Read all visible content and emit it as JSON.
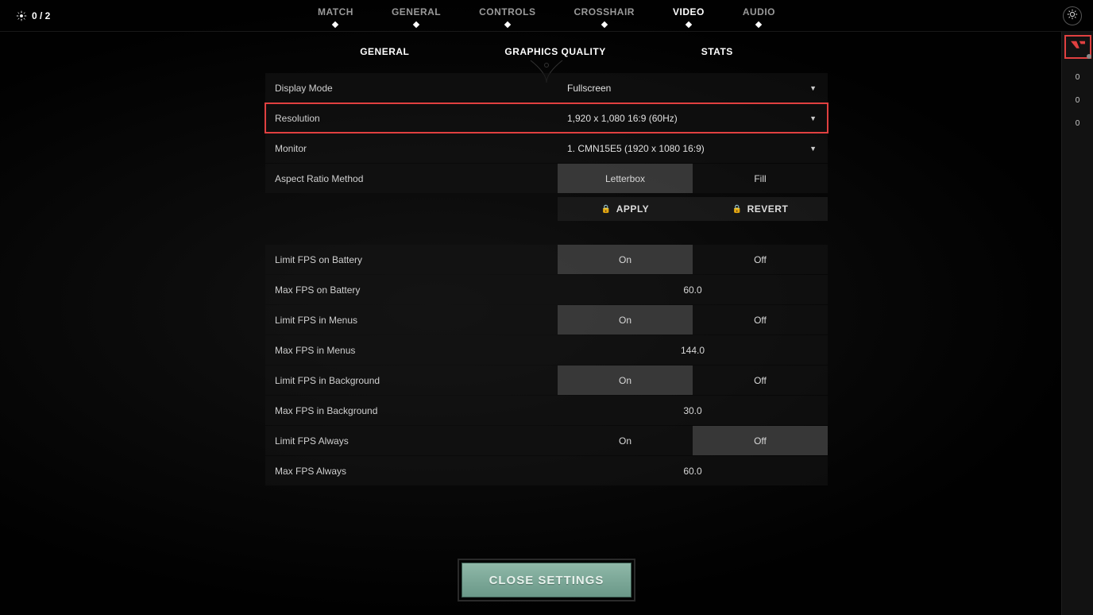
{
  "party": {
    "count": "0 / 2"
  },
  "mainTabs": [
    "MATCH",
    "GENERAL",
    "CONTROLS",
    "CROSSHAIR",
    "VIDEO",
    "AUDIO"
  ],
  "mainTabActive": "VIDEO",
  "subTabs": [
    "GENERAL",
    "GRAPHICS QUALITY",
    "STATS"
  ],
  "settings": {
    "displayMode": {
      "label": "Display Mode",
      "value": "Fullscreen"
    },
    "resolution": {
      "label": "Resolution",
      "value": "1,920 x 1,080 16:9 (60Hz)"
    },
    "monitor": {
      "label": "Monitor",
      "value": "1. CMN15E5 (1920 x  1080 16:9)"
    },
    "aspectRatio": {
      "label": "Aspect Ratio Method",
      "options": [
        "Letterbox",
        "Fill"
      ],
      "selected": "Letterbox"
    },
    "apply": "APPLY",
    "revert": "REVERT",
    "limitBattery": {
      "label": "Limit FPS on Battery",
      "options": [
        "On",
        "Off"
      ],
      "selected": "On"
    },
    "maxBattery": {
      "label": "Max FPS on Battery",
      "value": "60.0"
    },
    "limitMenus": {
      "label": "Limit FPS in Menus",
      "options": [
        "On",
        "Off"
      ],
      "selected": "On"
    },
    "maxMenus": {
      "label": "Max FPS in Menus",
      "value": "144.0"
    },
    "limitBackground": {
      "label": "Limit FPS in Background",
      "options": [
        "On",
        "Off"
      ],
      "selected": "On"
    },
    "maxBackground": {
      "label": "Max FPS in Background",
      "value": "30.0"
    },
    "limitAlways": {
      "label": "Limit FPS Always",
      "options": [
        "On",
        "Off"
      ],
      "selected": "Off"
    },
    "maxAlways": {
      "label": "Max FPS Always",
      "value": "60.0"
    }
  },
  "closeLabel": "CLOSE SETTINGS",
  "rail": {
    "items": [
      "0",
      "0",
      "0"
    ]
  }
}
